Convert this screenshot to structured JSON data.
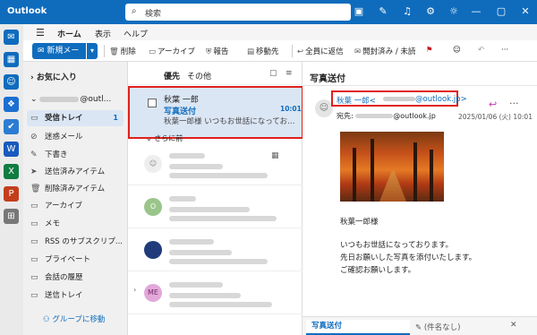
{
  "app": {
    "name": "Outlook"
  },
  "search": {
    "label": "検索"
  },
  "titlebar_icons": [
    "teams-icon",
    "note-icon",
    "bell-icon",
    "gear-icon",
    "lightbulb-icon"
  ],
  "window": {
    "minimize": "—",
    "restore": "▢",
    "close": "✕"
  },
  "menu": {
    "tabs": [
      "ホーム",
      "表示",
      "ヘルプ"
    ]
  },
  "ribbon": {
    "new_mail": "新規メール",
    "delete": "削除",
    "archive": "アーカイブ",
    "report": "報告",
    "move": "移動先",
    "reply_all": "全員に返信",
    "mark_read": "開封済み / 未読"
  },
  "folders": {
    "favorites": "お気に入り",
    "account_suffix": "@outl...",
    "items": [
      {
        "label": "受信トレイ",
        "count": "1"
      },
      {
        "label": "迷惑メール"
      },
      {
        "label": "下書き"
      },
      {
        "label": "送信済みアイテム"
      },
      {
        "label": "削除済みアイテム"
      },
      {
        "label": "アーカイブ"
      },
      {
        "label": "メモ"
      },
      {
        "label": "RSS のサブスクリプ..."
      },
      {
        "label": "プライベート"
      },
      {
        "label": "会話の履歴"
      },
      {
        "label": "送信トレイ"
      }
    ],
    "group_move": "グループに移動"
  },
  "msglist": {
    "tab_focused": "優先",
    "tab_other": "その他",
    "selected": {
      "sender": "秋葉 一郎",
      "subject": "写真送付",
      "time": "10:01",
      "preview": "秋葉一郎様 いつもお世話になっておりま..."
    },
    "section": "さらに前",
    "avatars": [
      "",
      "O",
      "",
      "ME"
    ]
  },
  "reading": {
    "title": "写真送付",
    "from_name": "秋葉 一郎<",
    "from_domain": "@outlook.jp>",
    "to_label": "宛先:",
    "to_domain": "@outlook.jp",
    "date": "2025/01/06 (火) 10:01",
    "body": [
      "秋葉一郎様",
      "いつもお世話になっております。",
      "先日お願いした写真を添付いたします。",
      "ご確認お願いします。"
    ],
    "compose_tab": "写真送付",
    "compose_tab2": "(件名なし)"
  }
}
